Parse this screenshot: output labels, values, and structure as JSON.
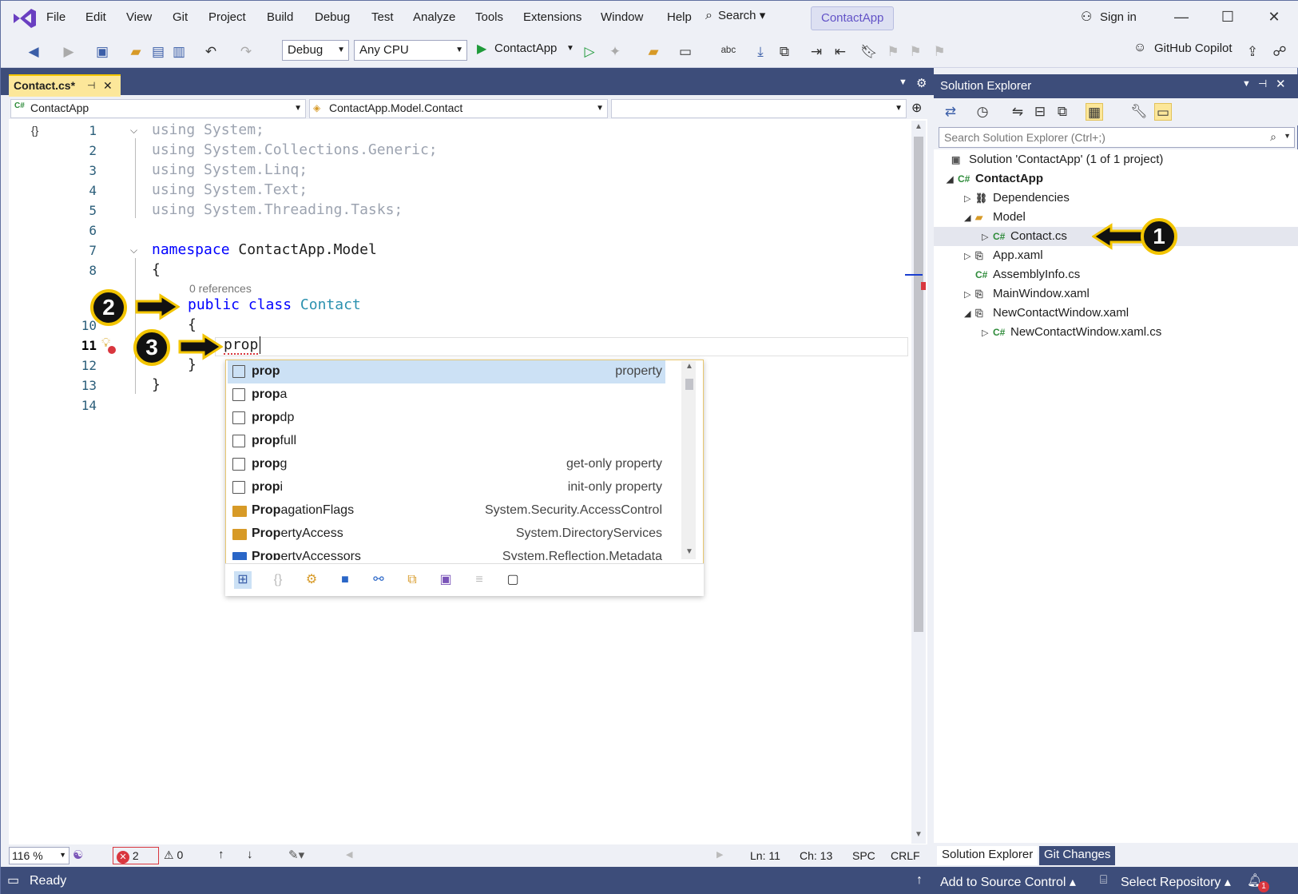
{
  "menu": [
    "File",
    "Edit",
    "View",
    "Git",
    "Project",
    "Build",
    "Debug",
    "Test",
    "Analyze",
    "Tools",
    "Extensions",
    "Window",
    "Help"
  ],
  "search_label": "Search",
  "app_name": "ContactApp",
  "sign_in": "Sign in",
  "toolbar": {
    "config": "Debug",
    "platform": "Any CPU",
    "run": "ContactApp",
    "copilot": "GitHub Copilot"
  },
  "doc_tab": "Contact.cs*",
  "nav": {
    "project": "ContactApp",
    "type": "ContactApp.Model.Contact",
    "member": ""
  },
  "code": {
    "lines": [
      "1",
      "2",
      "3",
      "4",
      "5",
      "6",
      "7",
      "8",
      "10",
      "11",
      "12",
      "13",
      "14"
    ],
    "using1": "using",
    "sys1": " System;",
    "using2": "using",
    "sys2": " System.Collections.Generic;",
    "using3": "using",
    "sys3": " System.Linq;",
    "using4": "using",
    "sys4": " System.Text;",
    "using5": "using",
    "sys5": " System.Threading.Tasks;",
    "ns_kw": "namespace",
    "ns_name": " ContactApp.Model",
    "brace_open": "{",
    "references": "0 references",
    "pub": "public",
    "cls": " class",
    "cls_name": " Contact",
    "inner_open": "{",
    "typed": "prop",
    "inner_close": "}",
    "outer_close": "}"
  },
  "completion": [
    {
      "bold": "prop",
      "rest": "",
      "desc": "property"
    },
    {
      "bold": "prop",
      "rest": "a",
      "desc": ""
    },
    {
      "bold": "prop",
      "rest": "dp",
      "desc": ""
    },
    {
      "bold": "prop",
      "rest": "full",
      "desc": ""
    },
    {
      "bold": "prop",
      "rest": "g",
      "desc": "get-only property"
    },
    {
      "bold": "prop",
      "rest": "i",
      "desc": "init-only property"
    },
    {
      "bold": "Prop",
      "rest": "agationFlags",
      "desc": "System.Security.AccessControl"
    },
    {
      "bold": "Prop",
      "rest": "ertyAccess",
      "desc": "System.DirectoryServices"
    },
    {
      "bold": "Prop",
      "rest": "ertyAccessors",
      "desc": "System.Reflection.Metadata"
    }
  ],
  "editor_status": {
    "zoom": "116 %",
    "errors": "2",
    "warnings": "0",
    "ln": "Ln: 11",
    "ch": "Ch: 13",
    "enc": "SPC",
    "eol": "CRLF"
  },
  "solution_explorer": {
    "title": "Solution Explorer",
    "search_placeholder": "Search Solution Explorer (Ctrl+;)",
    "tree": [
      {
        "label": "Solution 'ContactApp' (1 of 1 project)"
      },
      {
        "label": "ContactApp"
      },
      {
        "label": "Dependencies"
      },
      {
        "label": "Model"
      },
      {
        "label": "Contact.cs"
      },
      {
        "label": "App.xaml"
      },
      {
        "label": "AssemblyInfo.cs"
      },
      {
        "label": "MainWindow.xaml"
      },
      {
        "label": "NewContactWindow.xaml"
      },
      {
        "label": "NewContactWindow.xaml.cs"
      }
    ],
    "tabs": [
      "Solution Explorer",
      "Git Changes"
    ]
  },
  "status": {
    "ready": "Ready",
    "add_source": "Add to Source Control",
    "select_repo": "Select Repository",
    "notif": "1"
  },
  "annotations": [
    "1",
    "2",
    "3"
  ],
  "colors": {
    "accent": "#3d4d7a",
    "tab_active": "#fce79a",
    "badge_ring": "#f2c400"
  }
}
